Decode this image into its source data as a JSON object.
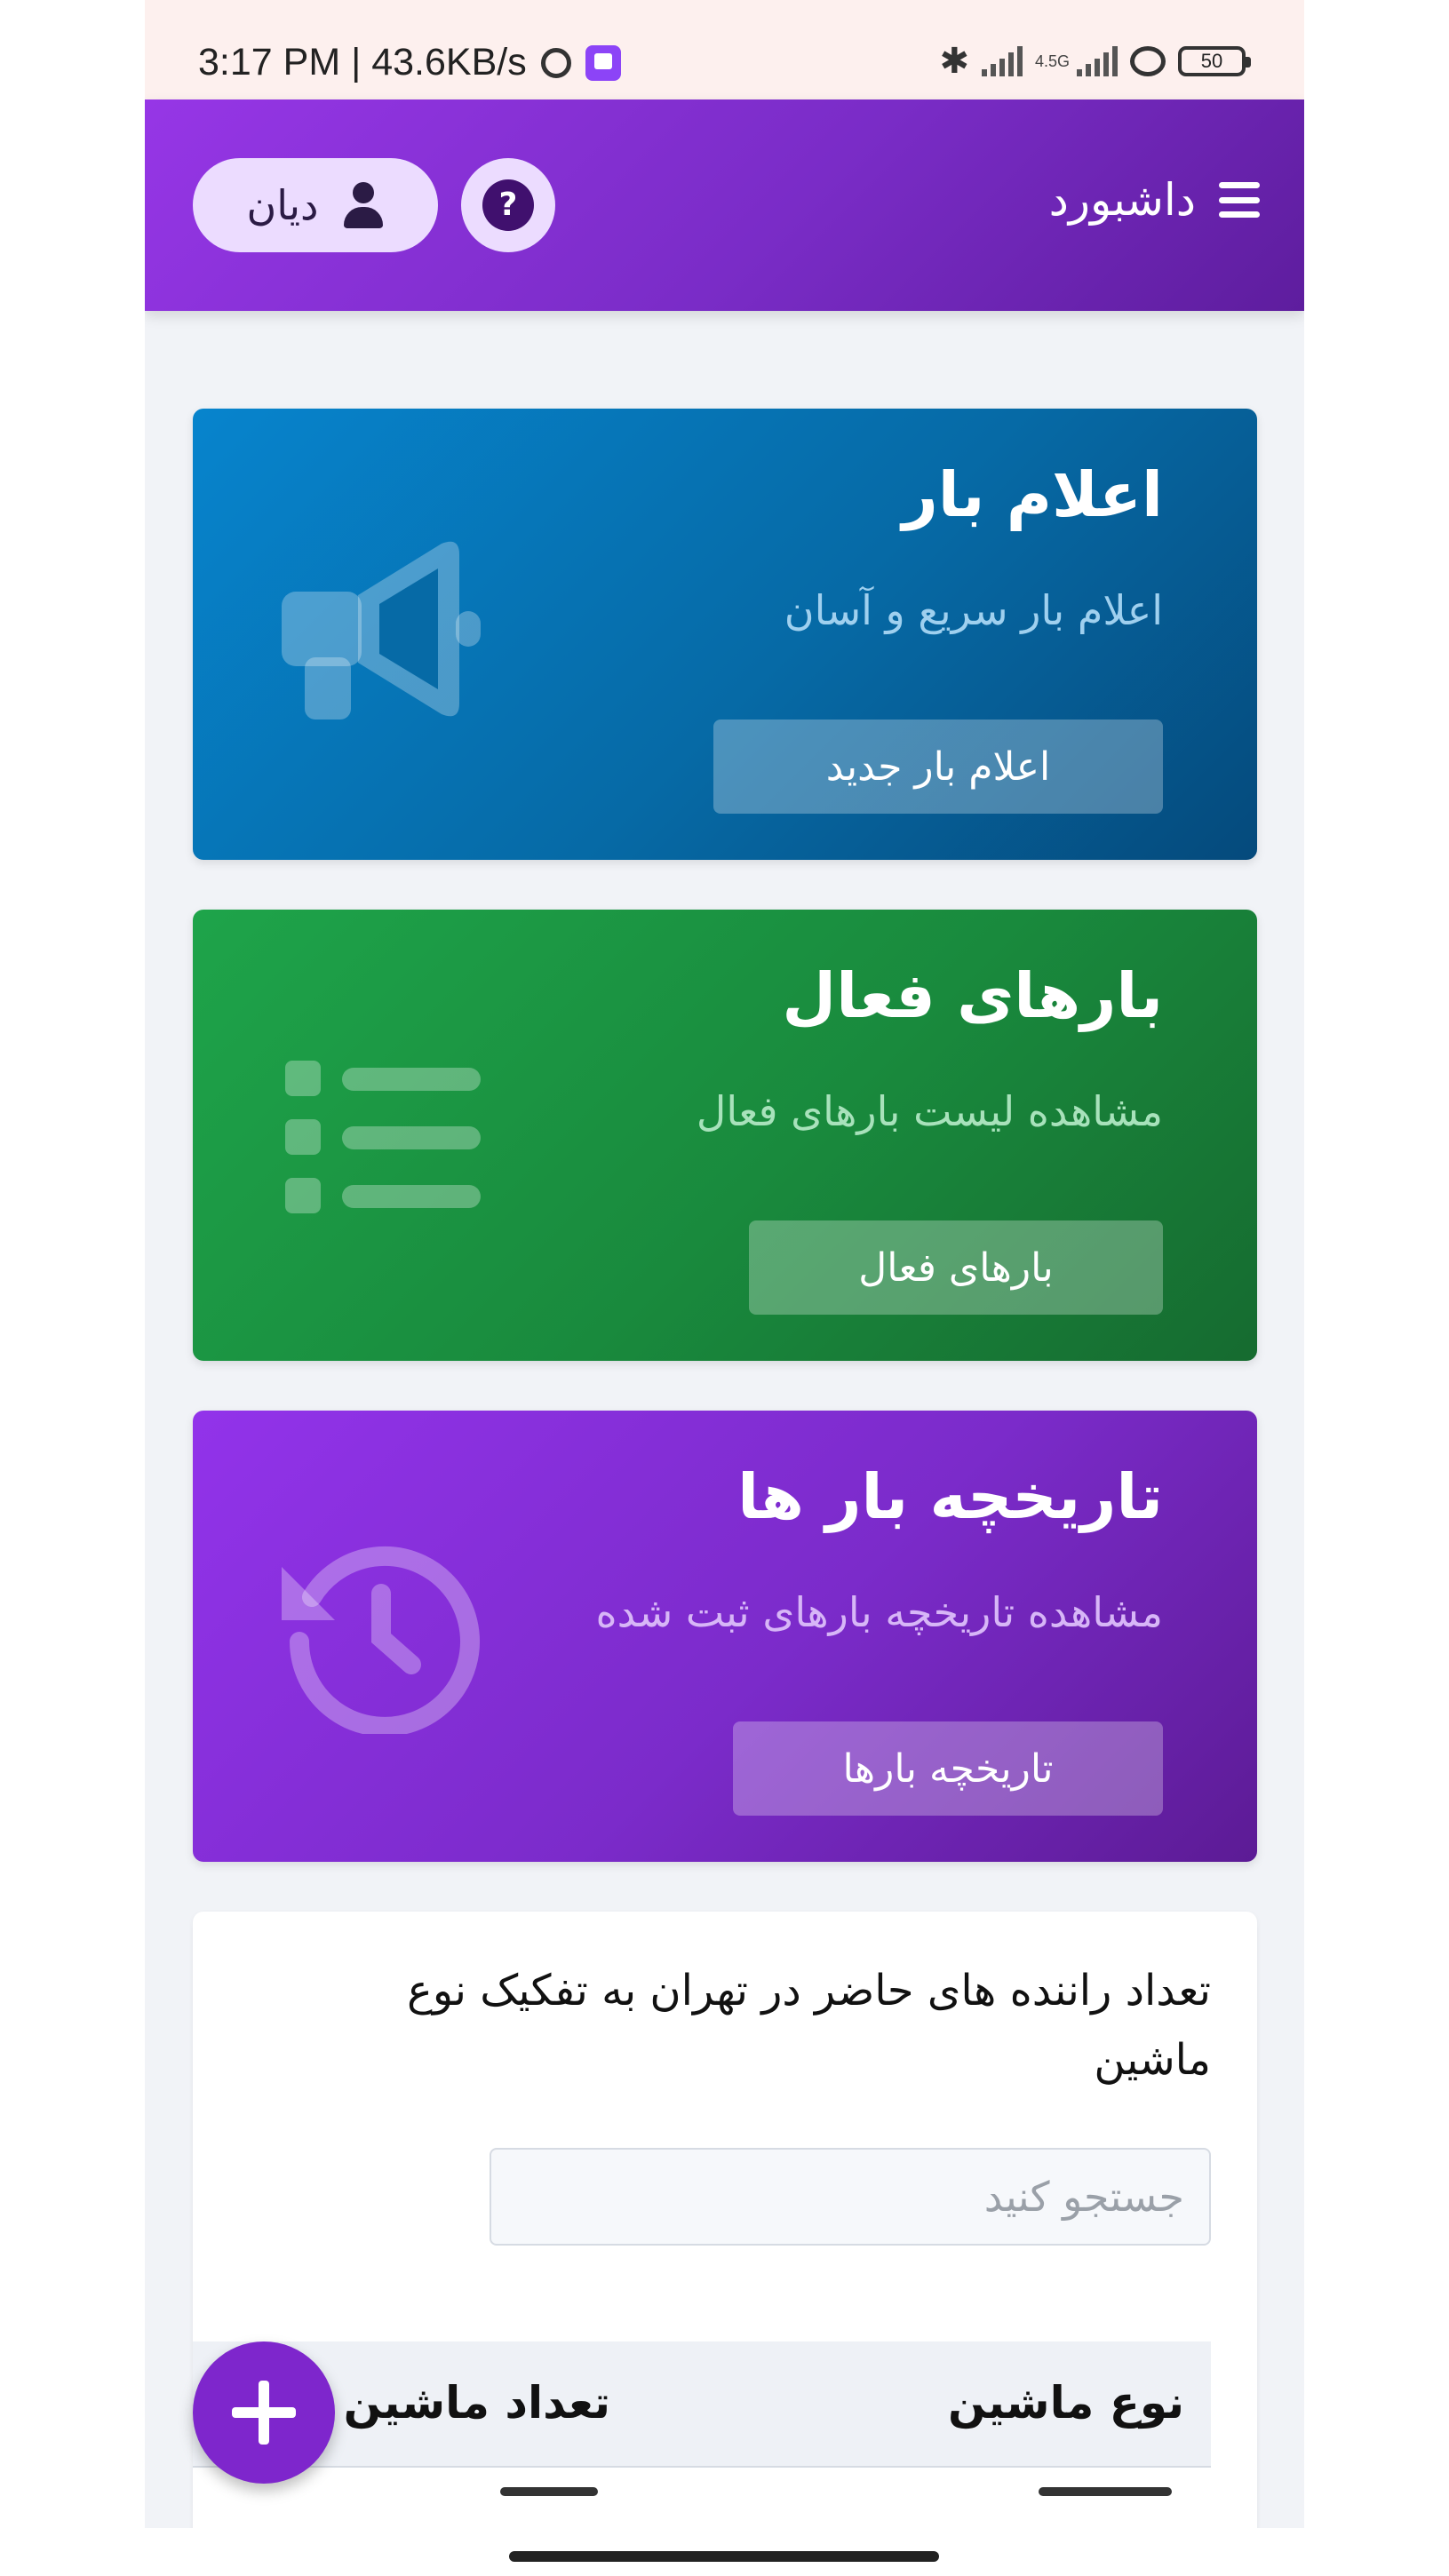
{
  "status_bar": {
    "time": "3:17 PM | 43.6KB/s",
    "network_label": "4.5G",
    "battery": "50",
    "icons": [
      "alarm-icon",
      "twitch-icon",
      "bluetooth-icon",
      "signal-icon",
      "signal-4g-icon",
      "link-icon",
      "battery-icon"
    ]
  },
  "app_bar": {
    "title": "داشبورد",
    "menu_icon": "hamburger-menu-icon",
    "help_icon": "?",
    "user_name": "دیان",
    "colors": {
      "from": "#9636e6",
      "to": "#5e1d9e"
    }
  },
  "cards": [
    {
      "title": "اعلام بار",
      "subtitle": "اعلام بار سریع و آسان",
      "button": "اعلام بار جدید",
      "icon": "megaphone-icon",
      "color": "#0784cd"
    },
    {
      "title": "بارهای فعال",
      "subtitle": "مشاهده لیست بارهای فعال",
      "button": "بارهای فعال",
      "icon": "list-icon",
      "color": "#1ea44a"
    },
    {
      "title": "تاریخچه بار ها",
      "subtitle": "مشاهده تاریخچه بارهای ثبت شده",
      "button": "تاریخچه بارها",
      "icon": "history-icon",
      "color": "#9233ea"
    }
  ],
  "drivers_panel": {
    "title": "تعداد راننده های حاضر در تهران به تفکیک نوع ماشین",
    "search_placeholder": "جستجو کنید",
    "columns": [
      "نوع ماشین",
      "تعداد ماشین"
    ]
  },
  "fab": {
    "icon": "plus-icon",
    "color": "#7e26cc"
  }
}
